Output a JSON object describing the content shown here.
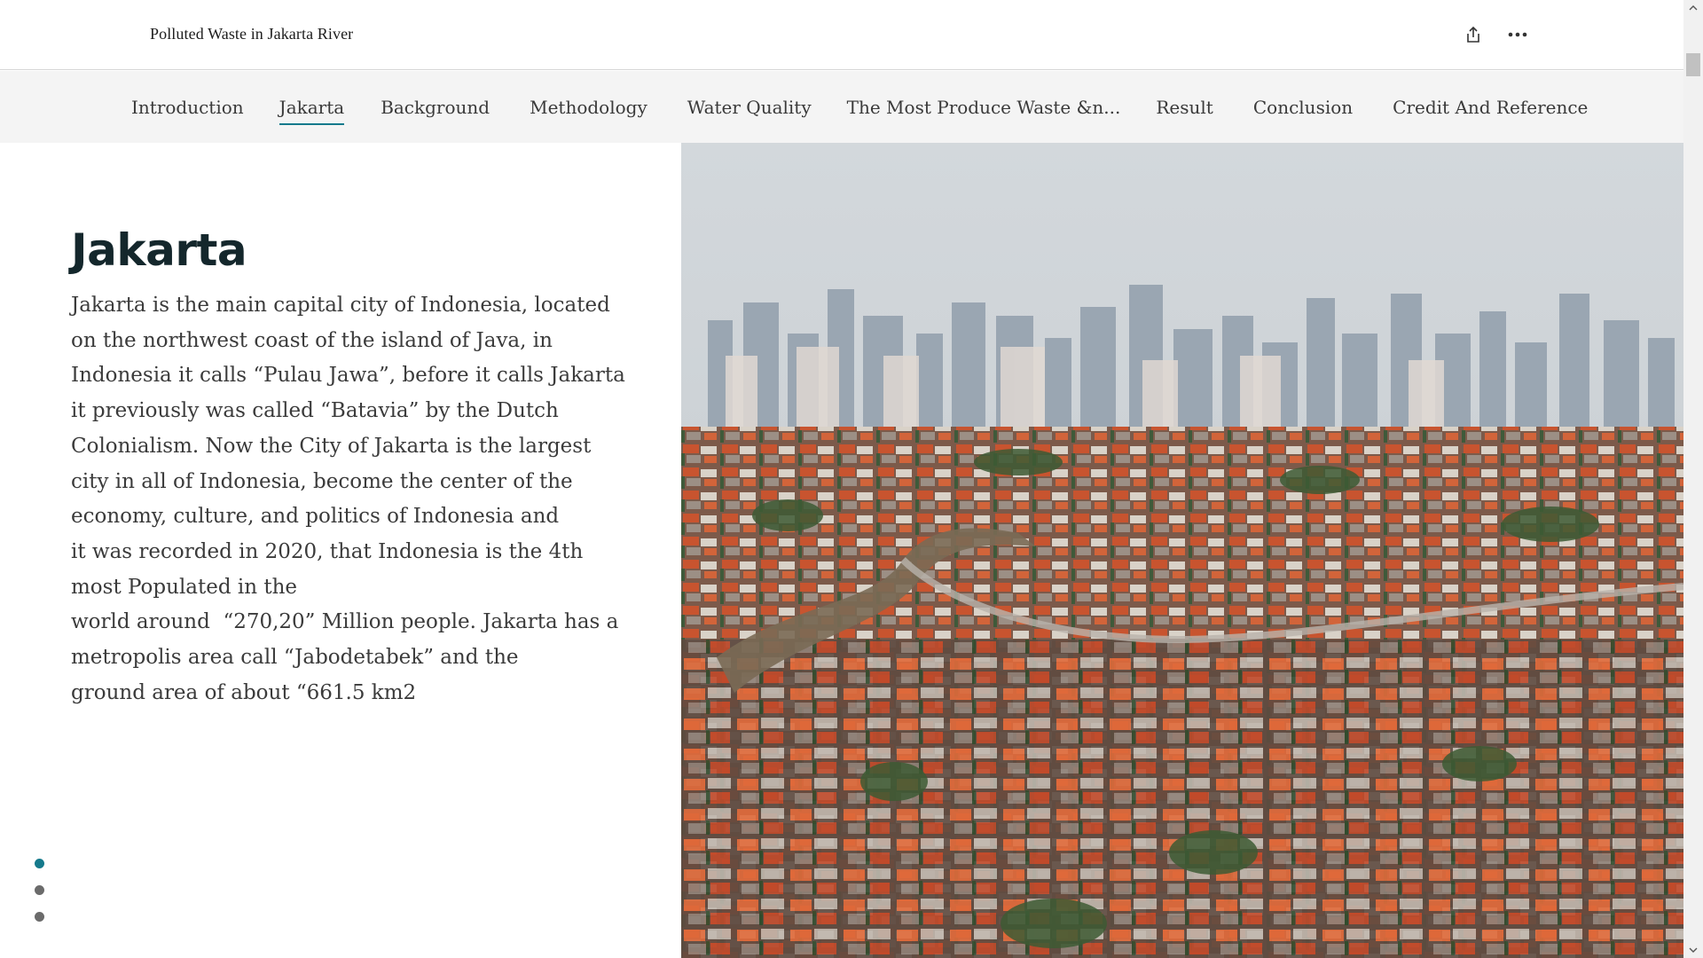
{
  "header": {
    "title": "Polluted Waste in Jakarta River",
    "share_icon": "share-icon",
    "more_icon": "more-horizontal-icon"
  },
  "nav": {
    "items": [
      {
        "label": "Introduction",
        "active": false
      },
      {
        "label": "Jakarta",
        "active": true
      },
      {
        "label": "Background",
        "active": false
      },
      {
        "label": "Methodology",
        "active": false
      },
      {
        "label": "Water Quality",
        "active": false
      },
      {
        "label": "The Most Produce Waste &n...",
        "active": false
      },
      {
        "label": "Result",
        "active": false
      },
      {
        "label": "Conclusion",
        "active": false
      },
      {
        "label": "Credit And Reference",
        "active": false
      }
    ]
  },
  "section": {
    "heading": "Jakarta",
    "lines": [
      "Jakarta is the main capital city of Indonesia, located",
      "on the northwest coast of the island of Java, in",
      "Indonesia it calls “Pulau Jawa”, before it calls Jakarta",
      "it previously was called “Batavia” by the Dutch",
      "Colonialism. Now the City of Jakarta is the largest",
      "city in all of Indonesia, become the center of the",
      "economy, culture, and politics of Indonesia and",
      "it was recorded in 2020, that Indonesia is the 4th",
      "most Populated in the",
      "world around  “270,20” Million people. Jakarta has a",
      "metropolis area call “Jabodetabek” and the",
      "ground area of about “661.5 km2"
    ]
  },
  "pager": {
    "count": 3,
    "active_index": 0
  },
  "colors": {
    "accent": "#157a8c",
    "heading": "#14272c",
    "nav_bg": "#f4f4f4"
  }
}
